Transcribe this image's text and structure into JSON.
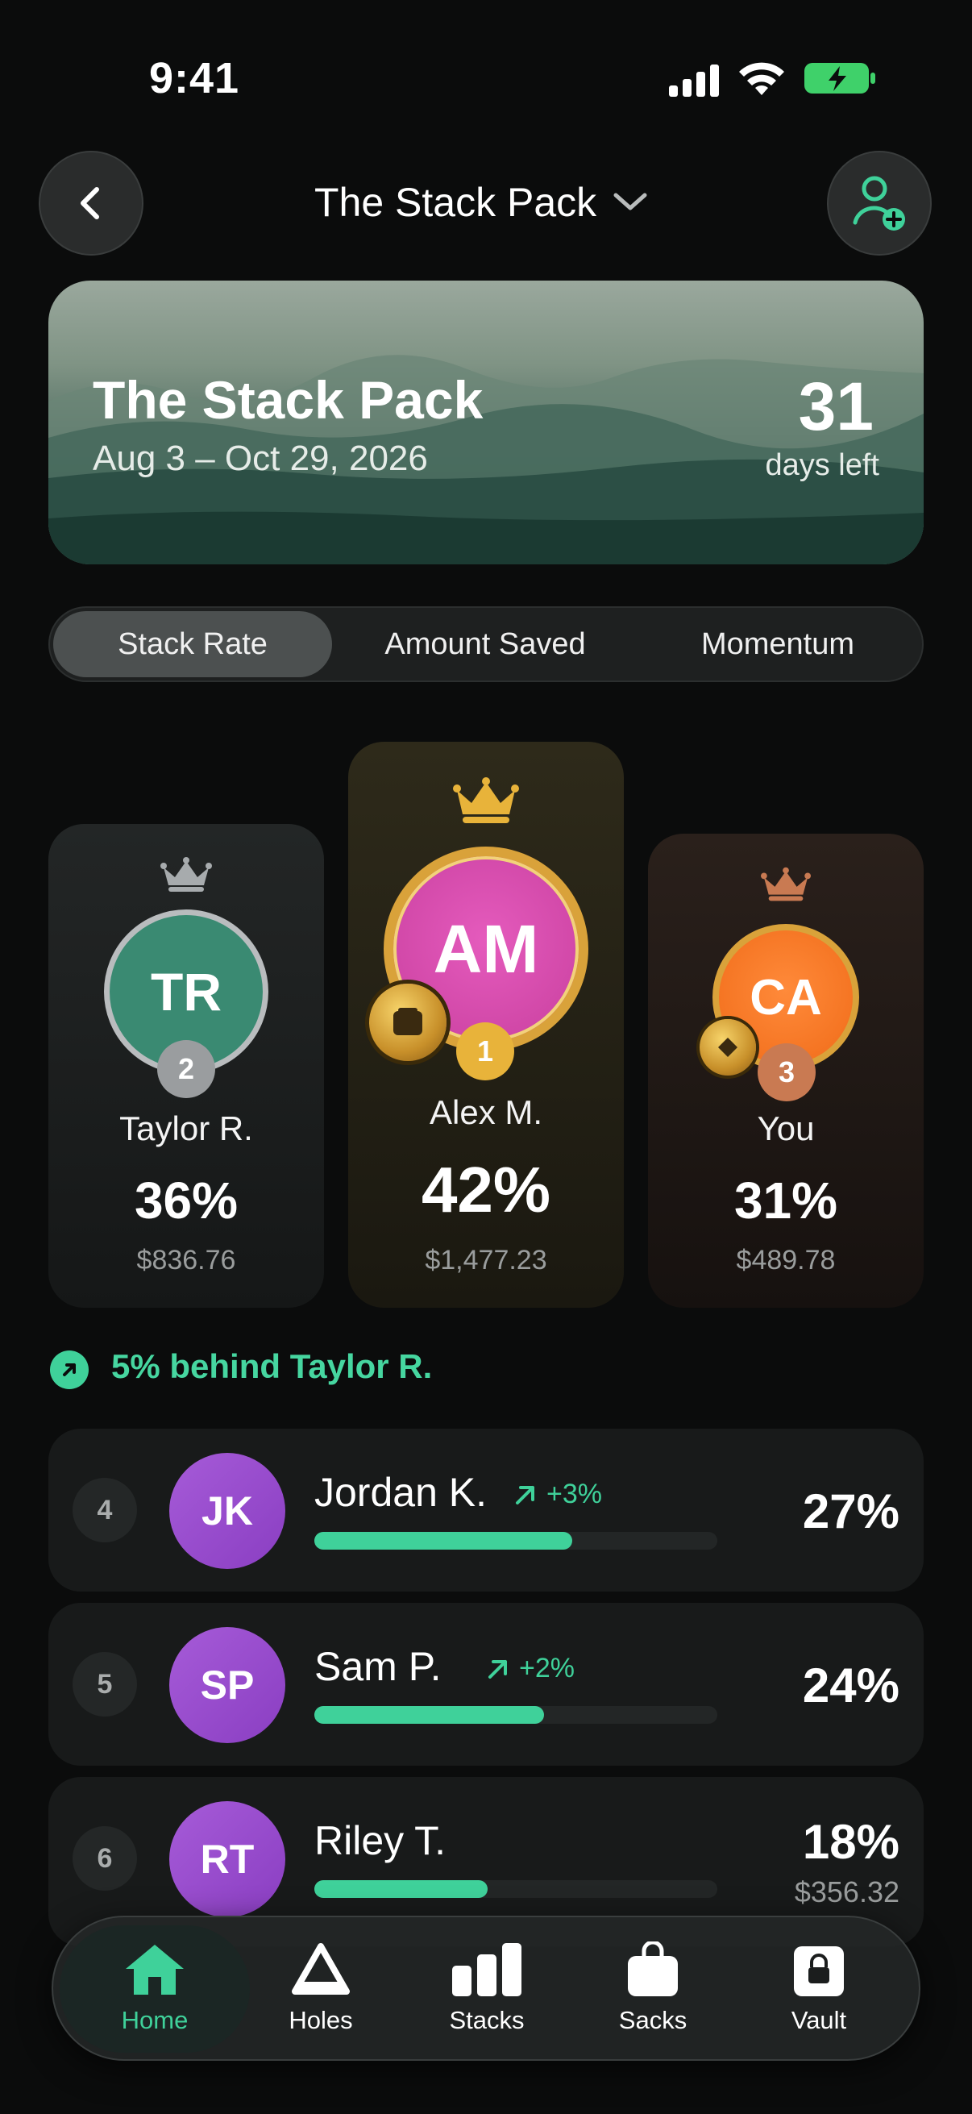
{
  "status_bar": {
    "time": "9:41"
  },
  "header": {
    "title": "The Stack Pack"
  },
  "banner": {
    "title": "The Stack Pack",
    "dates": "Aug 3 – Oct 29, 2026",
    "days_left": "31",
    "days_left_label": "days left"
  },
  "tabs": [
    {
      "label": "Stack Rate",
      "active": true
    },
    {
      "label": "Amount Saved",
      "active": false
    },
    {
      "label": "Momentum",
      "active": false
    }
  ],
  "podium": {
    "second": {
      "initials": "TR",
      "rank": "2",
      "name": "Taylor R.",
      "percent": "36%",
      "amount": "$836.76"
    },
    "first": {
      "initials": "AM",
      "rank": "1",
      "name": "Alex M.",
      "percent": "42%",
      "amount": "$1,477.23"
    },
    "third": {
      "initials": "CA",
      "rank": "3",
      "name": "You",
      "percent": "31%",
      "amount": "$489.78"
    }
  },
  "behind_text": "5% behind Taylor R.",
  "leaderboard": [
    {
      "rank": "4",
      "initials": "JK",
      "name": "Jordan K.",
      "delta": "+3%",
      "percent": "27%",
      "progress": 0.64
    },
    {
      "rank": "5",
      "initials": "SP",
      "name": "Sam P.",
      "delta": "+2%",
      "percent": "24%",
      "progress": 0.57
    },
    {
      "rank": "6",
      "initials": "RT",
      "name": "Riley T.",
      "percent": "18%",
      "amount": "$356.32",
      "progress": 0.43
    }
  ],
  "tab_bar": [
    {
      "label": "Home",
      "icon": "home-icon",
      "active": true
    },
    {
      "label": "Holes",
      "icon": "triangle-icon",
      "active": false
    },
    {
      "label": "Stacks",
      "icon": "bars-icon",
      "active": false
    },
    {
      "label": "Sacks",
      "icon": "bag-icon",
      "active": false
    },
    {
      "label": "Vault",
      "icon": "lock-icon",
      "active": false
    }
  ],
  "colors": {
    "accent": "#3fd19a",
    "gold": "#e8b33a",
    "silver": "#9a9d9f",
    "bronze": "#c97a52",
    "row_avatar": "#9b50d0"
  }
}
